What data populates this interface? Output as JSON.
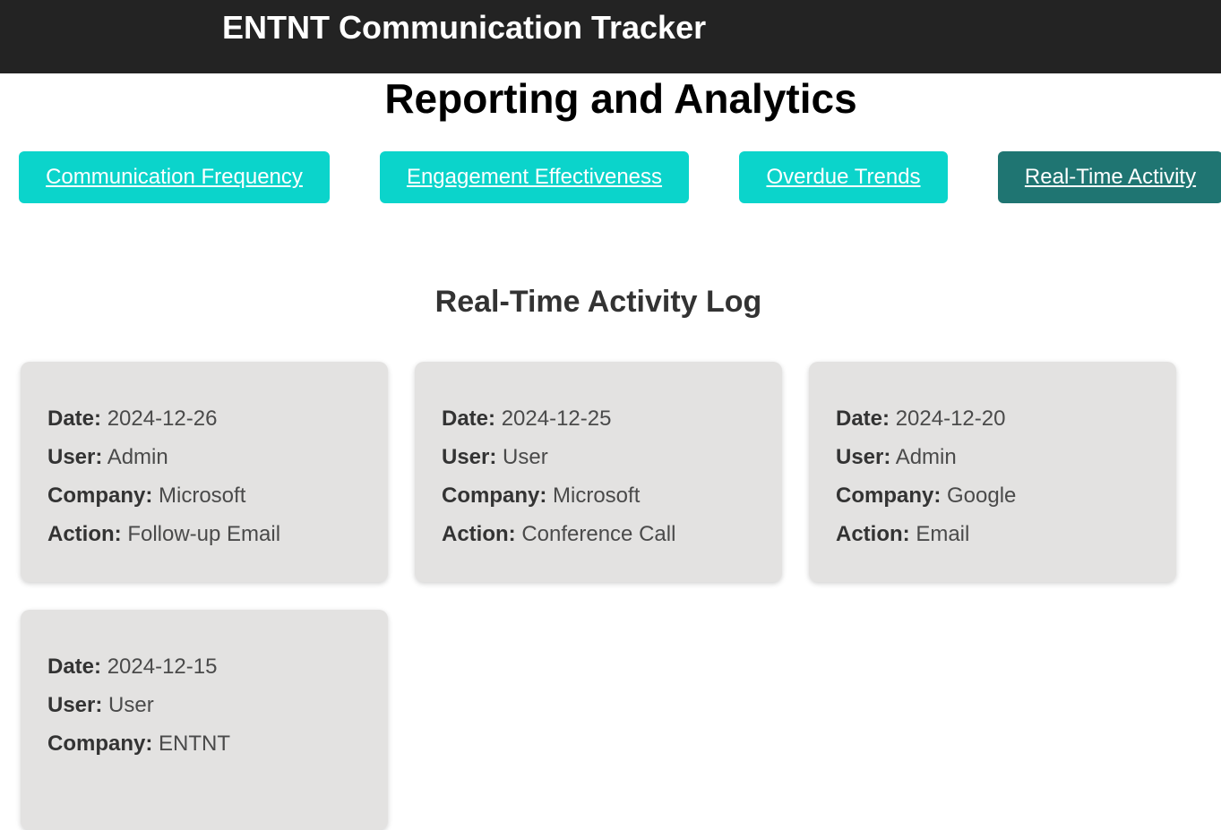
{
  "header": {
    "app_title": "ENTNT Communication Tracker"
  },
  "page": {
    "title": "Reporting and Analytics"
  },
  "tabs": [
    {
      "label": "Communication Frequency",
      "active": false
    },
    {
      "label": "Engagement Effectiveness",
      "active": false
    },
    {
      "label": "Overdue Trends",
      "active": false
    },
    {
      "label": "Real-Time Activity",
      "active": true
    }
  ],
  "colors": {
    "tab_default": "#0bd4cb",
    "tab_active": "#1f7572",
    "header_bg": "#232323",
    "card_bg": "#e3e2e1"
  },
  "section": {
    "title": "Real-Time Activity Log"
  },
  "field_labels": {
    "date": "Date:",
    "user": "User:",
    "company": "Company:",
    "action": "Action:"
  },
  "activities": [
    {
      "date": "2024-12-26",
      "user": "Admin",
      "company": "Microsoft",
      "action": "Follow-up Email"
    },
    {
      "date": "2024-12-25",
      "user": "User",
      "company": "Microsoft",
      "action": "Conference Call"
    },
    {
      "date": "2024-12-20",
      "user": "Admin",
      "company": "Google",
      "action": "Email"
    },
    {
      "date": "2024-12-15",
      "user": "User",
      "company": "ENTNT",
      "action": ""
    }
  ]
}
